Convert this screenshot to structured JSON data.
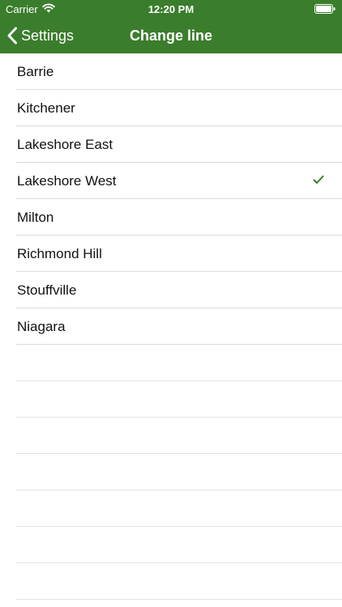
{
  "status_bar": {
    "carrier": "Carrier",
    "time": "12:20 PM",
    "icons": [
      "wifi-icon",
      "battery-icon"
    ]
  },
  "nav_bar": {
    "back_label": "Settings",
    "title": "Change line",
    "back_icon": "chevron-left-icon"
  },
  "lines": {
    "items": [
      {
        "label": "Barrie",
        "selected": false
      },
      {
        "label": "Kitchener",
        "selected": false
      },
      {
        "label": "Lakeshore East",
        "selected": false
      },
      {
        "label": "Lakeshore West",
        "selected": true
      },
      {
        "label": "Milton",
        "selected": false
      },
      {
        "label": "Richmond Hill",
        "selected": false
      },
      {
        "label": "Stouffville",
        "selected": false
      },
      {
        "label": "Niagara",
        "selected": false
      }
    ],
    "selected_icon": "checkmark-icon"
  },
  "colors": {
    "header_bg": "#3a7d2c",
    "accent": "#3a7d2c",
    "separator": "#dcdcdc"
  }
}
